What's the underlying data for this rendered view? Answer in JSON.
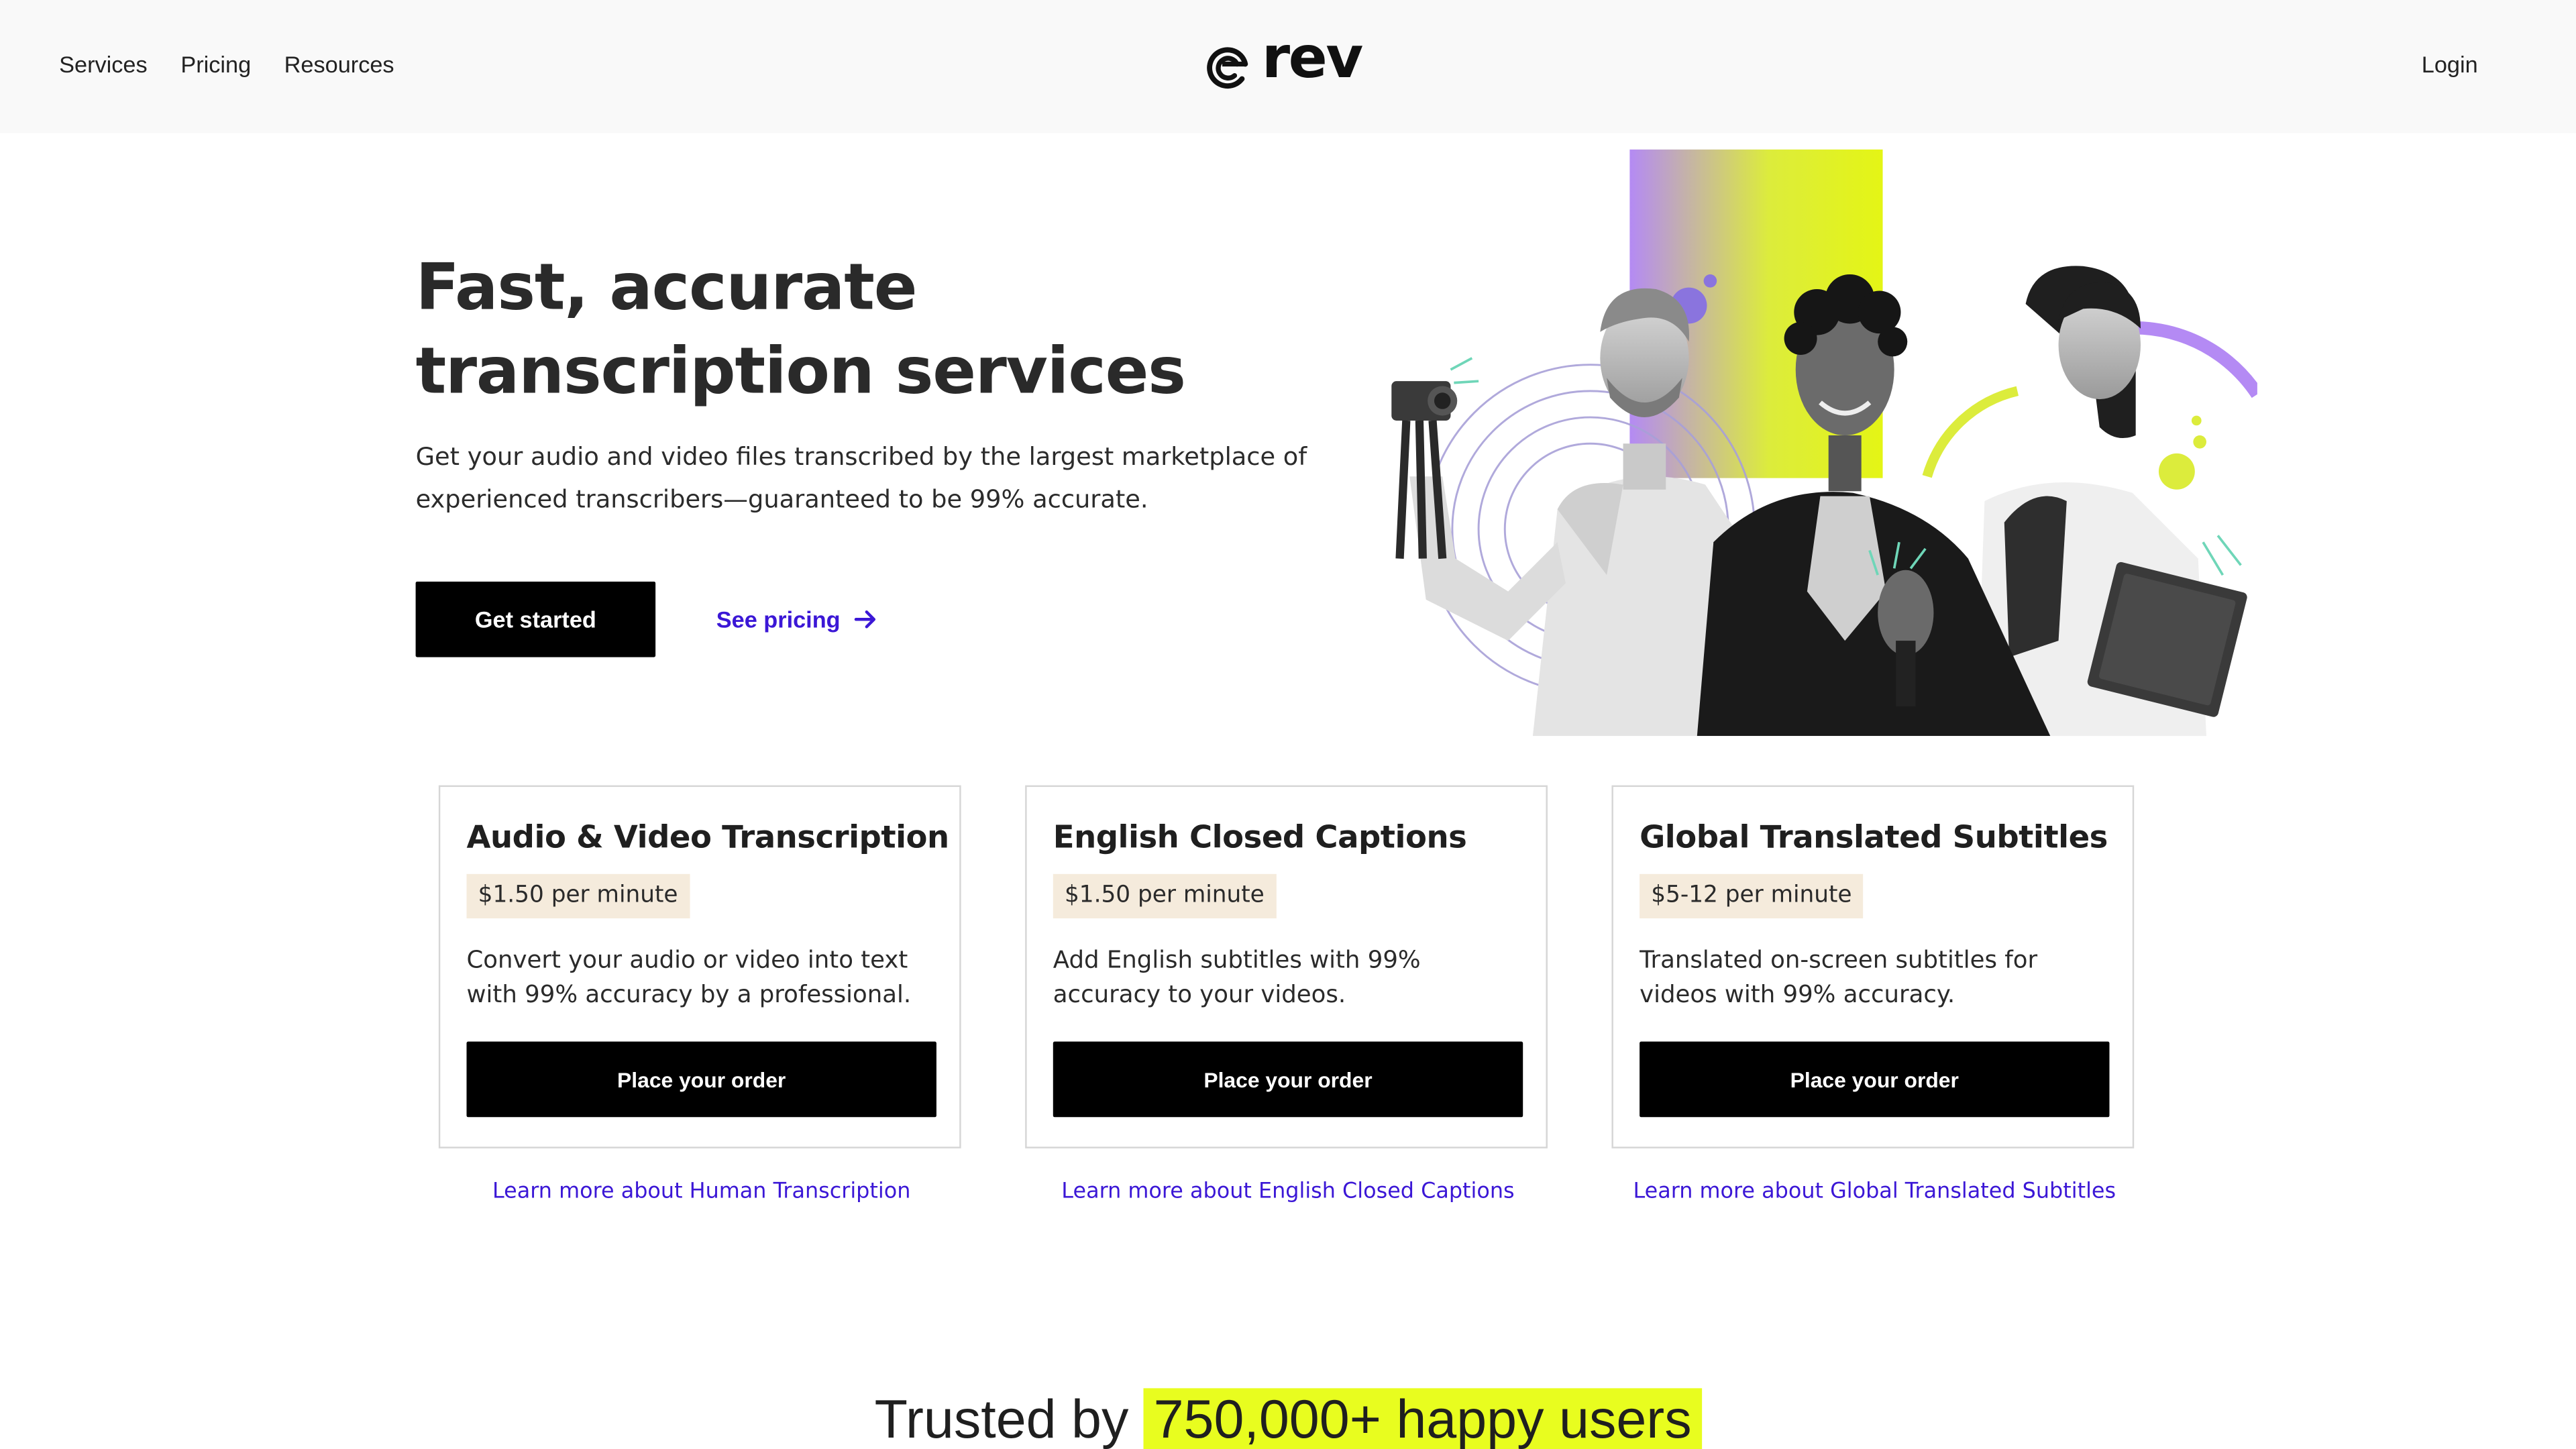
{
  "header": {
    "nav": [
      "Services",
      "Pricing",
      "Resources"
    ],
    "logo_text": "rev",
    "login": "Login"
  },
  "hero": {
    "title": "Fast, accurate transcription services",
    "subtitle": "Get your audio and video files transcribed by the largest marketplace of experienced transcribers—guaranteed to be 99% accurate.",
    "cta_primary": "Get started",
    "cta_secondary": "See pricing"
  },
  "cards": [
    {
      "title": "Audio & Video Transcription",
      "price": "$1.50 per minute",
      "description": "Convert your audio or video into text with 99% accuracy by a professional.",
      "button": "Place your order",
      "learn_more": "Learn more about Human Transcription"
    },
    {
      "title": "English Closed Captions",
      "price": "$1.50 per minute",
      "description": "Add English subtitles with 99% accuracy to your videos.",
      "button": "Place your order",
      "learn_more": "Learn more about English Closed Captions"
    },
    {
      "title": "Global Translated Subtitles",
      "price": "$5-12 per minute",
      "description": "Translated on-screen subtitles for videos with 99% accuracy.",
      "button": "Place your order",
      "learn_more": "Learn more about Global Translated Subtitles"
    }
  ],
  "trusted": {
    "prefix": "Trusted by",
    "highlight": "750,000+ happy users"
  },
  "colors": {
    "accent_link": "#3b17d6",
    "highlight": "#e8fd1f",
    "price_badge": "#f5ebdc",
    "header_bg": "#f9f9f9"
  }
}
